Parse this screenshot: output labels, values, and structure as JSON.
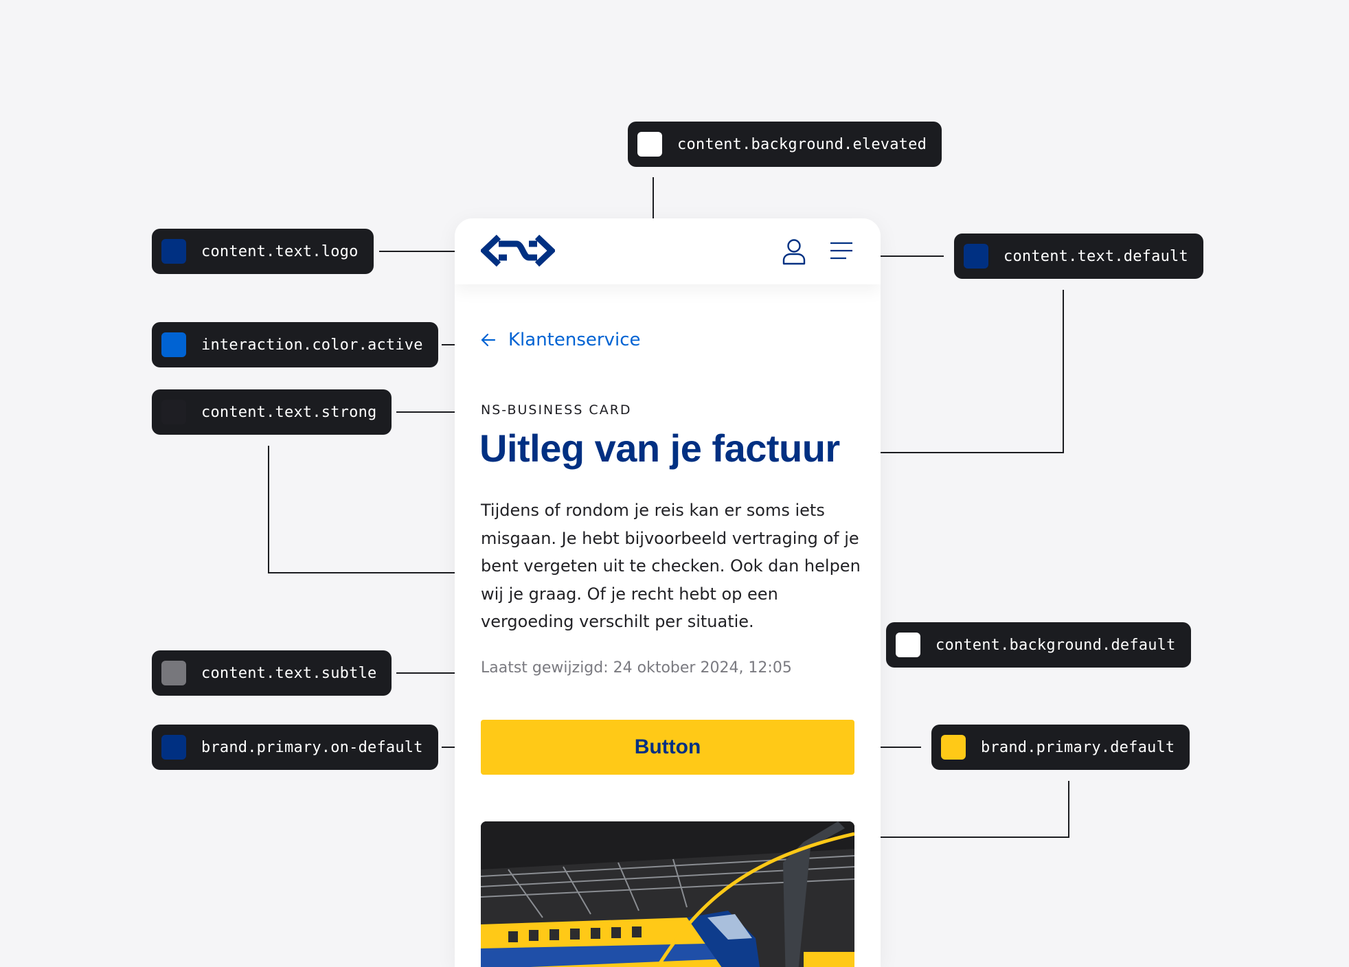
{
  "tokens": {
    "elevated": {
      "name": "content.background.elevated",
      "color": "#ffffff"
    },
    "logo": {
      "name": "content.text.logo",
      "color": "#003082"
    },
    "text_default": {
      "name": "content.text.default",
      "color": "#003082"
    },
    "interaction_active": {
      "name": "interaction.color.active",
      "color": "#0063d3"
    },
    "text_strong": {
      "name": "content.text.strong",
      "color": "#1e1e23"
    },
    "background_default": {
      "name": "content.background.default",
      "color": "#ffffff"
    },
    "text_subtle": {
      "name": "content.text.subtle",
      "color": "#77777c"
    },
    "on_default": {
      "name": "brand.primary.on-default",
      "color": "#003082"
    },
    "primary_default": {
      "name": "brand.primary.default",
      "color": "#ffc917"
    }
  },
  "phone": {
    "back_link": "Klantenservice",
    "eyebrow": "NS-BUSINESS CARD",
    "title": "Uitleg van je factuur",
    "body": "Tijdens of rondom je reis kan er soms iets misgaan. Je hebt bijvoorbeeld vertraging of je bent vergeten uit te checken. Ook dan helpen wij je graag. Of je recht hebt op een vergoeding verschilt per situatie.",
    "meta": "Laatst gewijzigd: 24 oktober 2024, 12:05",
    "button_label": "Button"
  },
  "icons": {
    "logo": "ns-logo-icon",
    "user": "user-icon",
    "menu": "menu-icon",
    "back": "arrow-left-icon"
  }
}
